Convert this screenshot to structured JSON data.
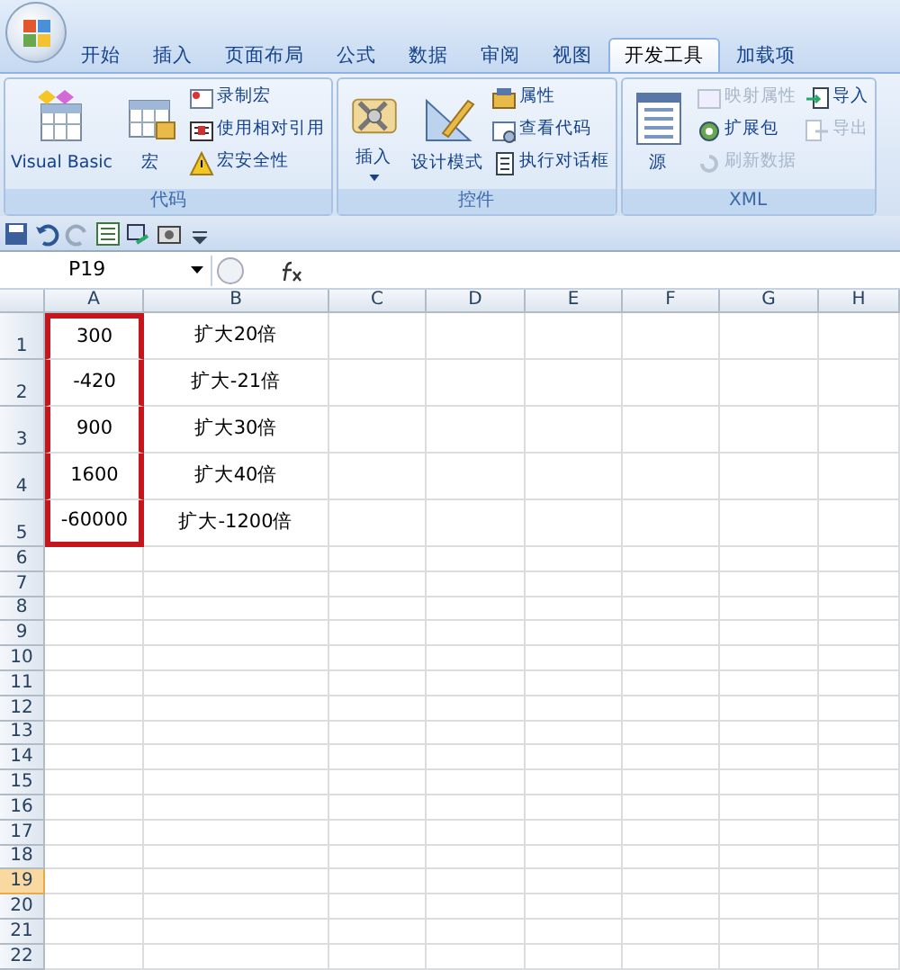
{
  "tabs": [
    {
      "label": "开始",
      "selected": false
    },
    {
      "label": "插入",
      "selected": false
    },
    {
      "label": "页面布局",
      "selected": false
    },
    {
      "label": "公式",
      "selected": false
    },
    {
      "label": "数据",
      "selected": false
    },
    {
      "label": "审阅",
      "selected": false
    },
    {
      "label": "视图",
      "selected": false
    },
    {
      "label": "开发工具",
      "selected": true
    },
    {
      "label": "加载项",
      "selected": false
    }
  ],
  "ribbon_groups": [
    {
      "label": "代码",
      "large": [
        {
          "label": "Visual Basic"
        },
        {
          "label": "宏"
        }
      ],
      "small": [
        [
          {
            "label": "录制宏",
            "disabled": false
          },
          {
            "label": "使用相对引用",
            "disabled": false
          },
          {
            "label": "宏安全性",
            "disabled": false
          }
        ]
      ]
    },
    {
      "label": "控件",
      "large": [
        {
          "label": "插入"
        },
        {
          "label": "设计模式"
        }
      ],
      "small": [
        [
          {
            "label": "属性",
            "disabled": false
          },
          {
            "label": "查看代码",
            "disabled": false
          },
          {
            "label": "执行对话框",
            "disabled": false
          }
        ]
      ]
    },
    {
      "label": "XML",
      "large": [
        {
          "label": "源"
        }
      ],
      "small": [
        [
          {
            "label": "映射属性",
            "disabled": true
          },
          {
            "label": "扩展包",
            "disabled": false
          },
          {
            "label": "刷新数据",
            "disabled": true
          }
        ],
        [
          {
            "label": "导入",
            "disabled": false
          },
          {
            "label": "导出",
            "disabled": true
          }
        ]
      ]
    }
  ],
  "name_box": "P19",
  "columns": [
    "A",
    "B",
    "C",
    "D",
    "E",
    "F",
    "G",
    "H"
  ],
  "rows": [
    {
      "number": "1",
      "a": "300",
      "b": "扩大20倍",
      "boxed": true,
      "selected": false
    },
    {
      "number": "2",
      "a": "-420",
      "b": "扩大-21倍",
      "boxed": true,
      "selected": false
    },
    {
      "number": "3",
      "a": "900",
      "b": "扩大30倍",
      "boxed": true,
      "selected": false
    },
    {
      "number": "4",
      "a": "1600",
      "b": "扩大40倍",
      "boxed": true,
      "selected": false
    },
    {
      "number": "5",
      "a": "-60000",
      "b": "扩大-1200倍",
      "boxed": true,
      "selected": false
    },
    {
      "number": "6",
      "boxed": false,
      "selected": false
    },
    {
      "number": "7",
      "boxed": false,
      "selected": false
    },
    {
      "number": "8",
      "boxed": false,
      "selected": false
    },
    {
      "number": "9",
      "boxed": false,
      "selected": false
    },
    {
      "number": "10",
      "boxed": false,
      "selected": false
    },
    {
      "number": "11",
      "boxed": false,
      "selected": false
    },
    {
      "number": "12",
      "boxed": false,
      "selected": false
    },
    {
      "number": "13",
      "boxed": false,
      "selected": false
    },
    {
      "number": "14",
      "boxed": false,
      "selected": false
    },
    {
      "number": "15",
      "boxed": false,
      "selected": false
    },
    {
      "number": "16",
      "boxed": false,
      "selected": false
    },
    {
      "number": "17",
      "boxed": false,
      "selected": false
    },
    {
      "number": "18",
      "boxed": false,
      "selected": false
    },
    {
      "number": "19",
      "boxed": false,
      "selected": true
    },
    {
      "number": "20",
      "boxed": false,
      "selected": false
    },
    {
      "number": "21",
      "boxed": false,
      "selected": false
    },
    {
      "number": "22",
      "boxed": false,
      "selected": false
    }
  ]
}
